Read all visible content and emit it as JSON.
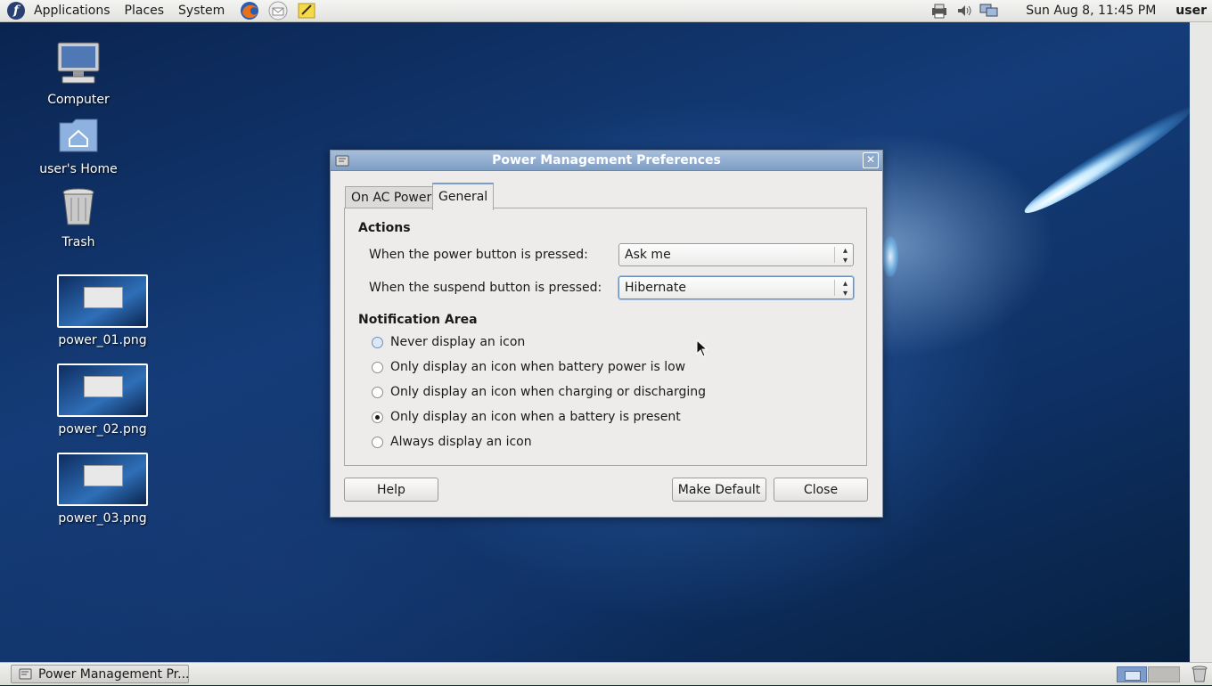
{
  "top_panel": {
    "menus": [
      "Applications",
      "Places",
      "System"
    ],
    "launchers": [
      "firefox-icon",
      "mail-icon",
      "notes-icon"
    ],
    "tray_icons": [
      "printer-icon",
      "volume-icon",
      "network-icon"
    ],
    "clock": "Sun Aug  8, 11:45 PM",
    "username": "user"
  },
  "desktop": {
    "icons": [
      {
        "label": "Computer",
        "icon": "computer-icon"
      },
      {
        "label": "user's Home",
        "icon": "home-folder-icon"
      },
      {
        "label": "Trash",
        "icon": "trash-icon"
      },
      {
        "label": "power_01.png",
        "icon": "image-thumbnail"
      },
      {
        "label": "power_02.png",
        "icon": "image-thumbnail"
      },
      {
        "label": "power_03.png",
        "icon": "image-thumbnail"
      }
    ]
  },
  "dialog": {
    "title": "Power Management Preferences",
    "close_glyph": "✕",
    "tabs": [
      {
        "label": "On AC Power",
        "active": false
      },
      {
        "label": "General",
        "active": true
      }
    ],
    "actions": {
      "heading": "Actions",
      "power_button_label": "When the power button is pressed:",
      "power_button_value": "Ask me",
      "suspend_button_label": "When the suspend button is pressed:",
      "suspend_button_value": "Hibernate"
    },
    "notification": {
      "heading": "Notification Area",
      "options": [
        {
          "label": "Never display an icon",
          "selected": false
        },
        {
          "label": "Only display an icon when battery power is low",
          "selected": false
        },
        {
          "label": "Only display an icon when charging or discharging",
          "selected": false
        },
        {
          "label": "Only display an icon when a battery is present",
          "selected": true
        },
        {
          "label": "Always display an icon",
          "selected": false
        }
      ]
    },
    "buttons": {
      "help": "Help",
      "make_default": "Make Default",
      "close": "Close"
    }
  },
  "bottom_panel": {
    "task": "Power Management Pr...",
    "workspaces": 2,
    "active_workspace": 1
  },
  "colors": {
    "titlebar": "#7e9dc4",
    "panel": "#e8e8e6",
    "dialog_bg": "#edeceb",
    "wallpaper": "#143c78"
  }
}
